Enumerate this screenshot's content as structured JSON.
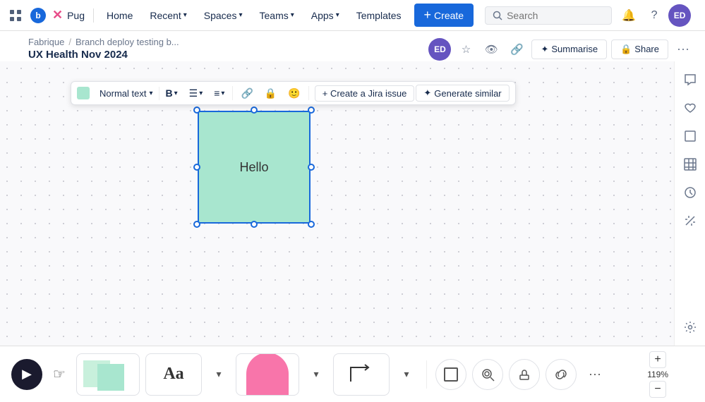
{
  "topnav": {
    "brand": "Pug",
    "home_label": "Home",
    "recent_label": "Recent",
    "spaces_label": "Spaces",
    "teams_label": "Teams",
    "apps_label": "Apps",
    "templates_label": "Templates",
    "create_label": "Create",
    "search_placeholder": "Search",
    "avatar_initials": "ED"
  },
  "breadcrumb": {
    "item1": "Fabrique",
    "item2": "Branch deploy testing b...",
    "sep": "/"
  },
  "page": {
    "title": "UX Health Nov 2024"
  },
  "title_actions": {
    "summarise_label": "Summarise",
    "share_label": "Share"
  },
  "toolbar": {
    "color_swatch": "#a8e6cf",
    "text_style": "Normal text",
    "bold_label": "B",
    "list_label": "≡",
    "align_label": "≡",
    "link_label": "🔗",
    "lock_label": "🔒",
    "emoji_label": "😊",
    "create_jira_label": "+ Create a Jira issue",
    "generate_label": "Generate similar"
  },
  "canvas": {
    "box_text": "Hello",
    "box_bg": "#a8e6cf"
  },
  "bottom_toolbar": {
    "play_icon": "▶",
    "cursor_icon": "☞",
    "more_label": "•••",
    "dropdown_arrow": "▾"
  },
  "zoom": {
    "level": "119%",
    "plus": "+",
    "minus": "−"
  },
  "right_sidebar": {
    "comment_icon": "💬",
    "like_icon": "👍",
    "frame_icon": "⬜",
    "table_icon": "⊞",
    "history_icon": "🕐",
    "wand_icon": "✦",
    "settings_icon": "⚙"
  }
}
